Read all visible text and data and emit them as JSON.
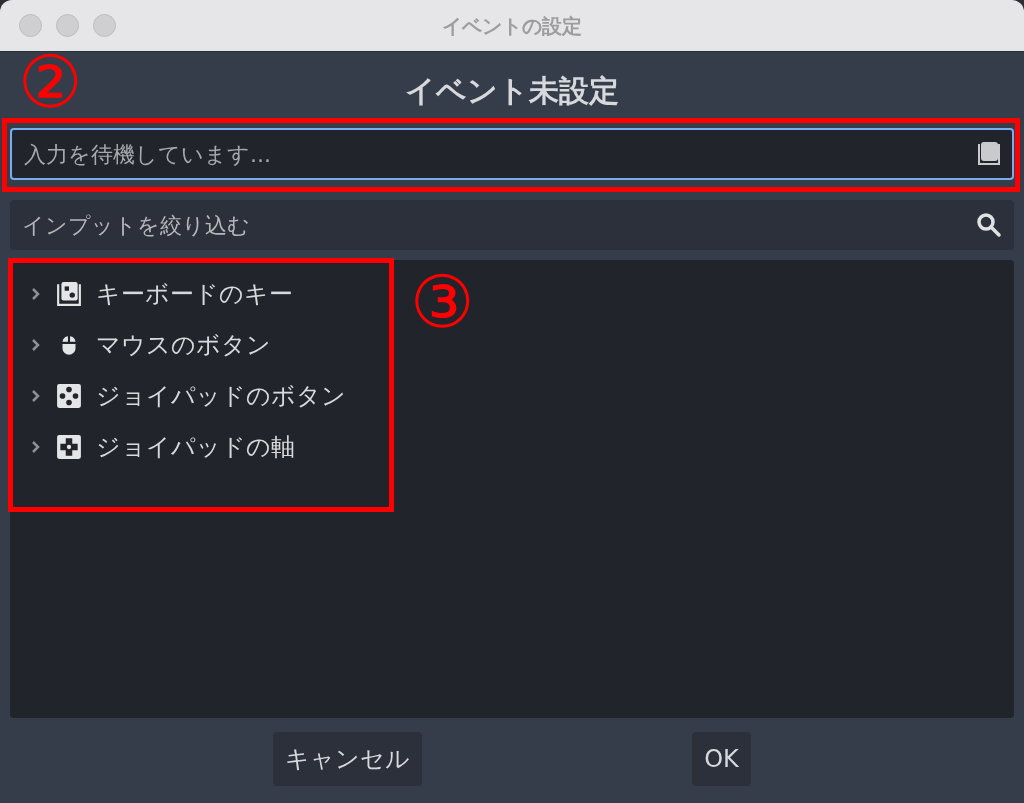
{
  "window": {
    "title": "イベントの設定"
  },
  "heading": "イベント未設定",
  "input": {
    "placeholder": "入力を待機しています...",
    "focused": true
  },
  "filter": {
    "placeholder": "インプットを絞り込む"
  },
  "tree": [
    {
      "kind": "keyboard",
      "label": "キーボードのキー",
      "expanded": false
    },
    {
      "kind": "mouse",
      "label": "マウスのボタン",
      "expanded": false
    },
    {
      "kind": "joypad-button",
      "label": "ジョイパッドのボタン",
      "expanded": false
    },
    {
      "kind": "joypad-axis",
      "label": "ジョイパッドの軸",
      "expanded": false
    }
  ],
  "annotations": {
    "input_marker": "②",
    "tree_marker": "③"
  },
  "buttons": [
    "キャンセル",
    "OK"
  ]
}
